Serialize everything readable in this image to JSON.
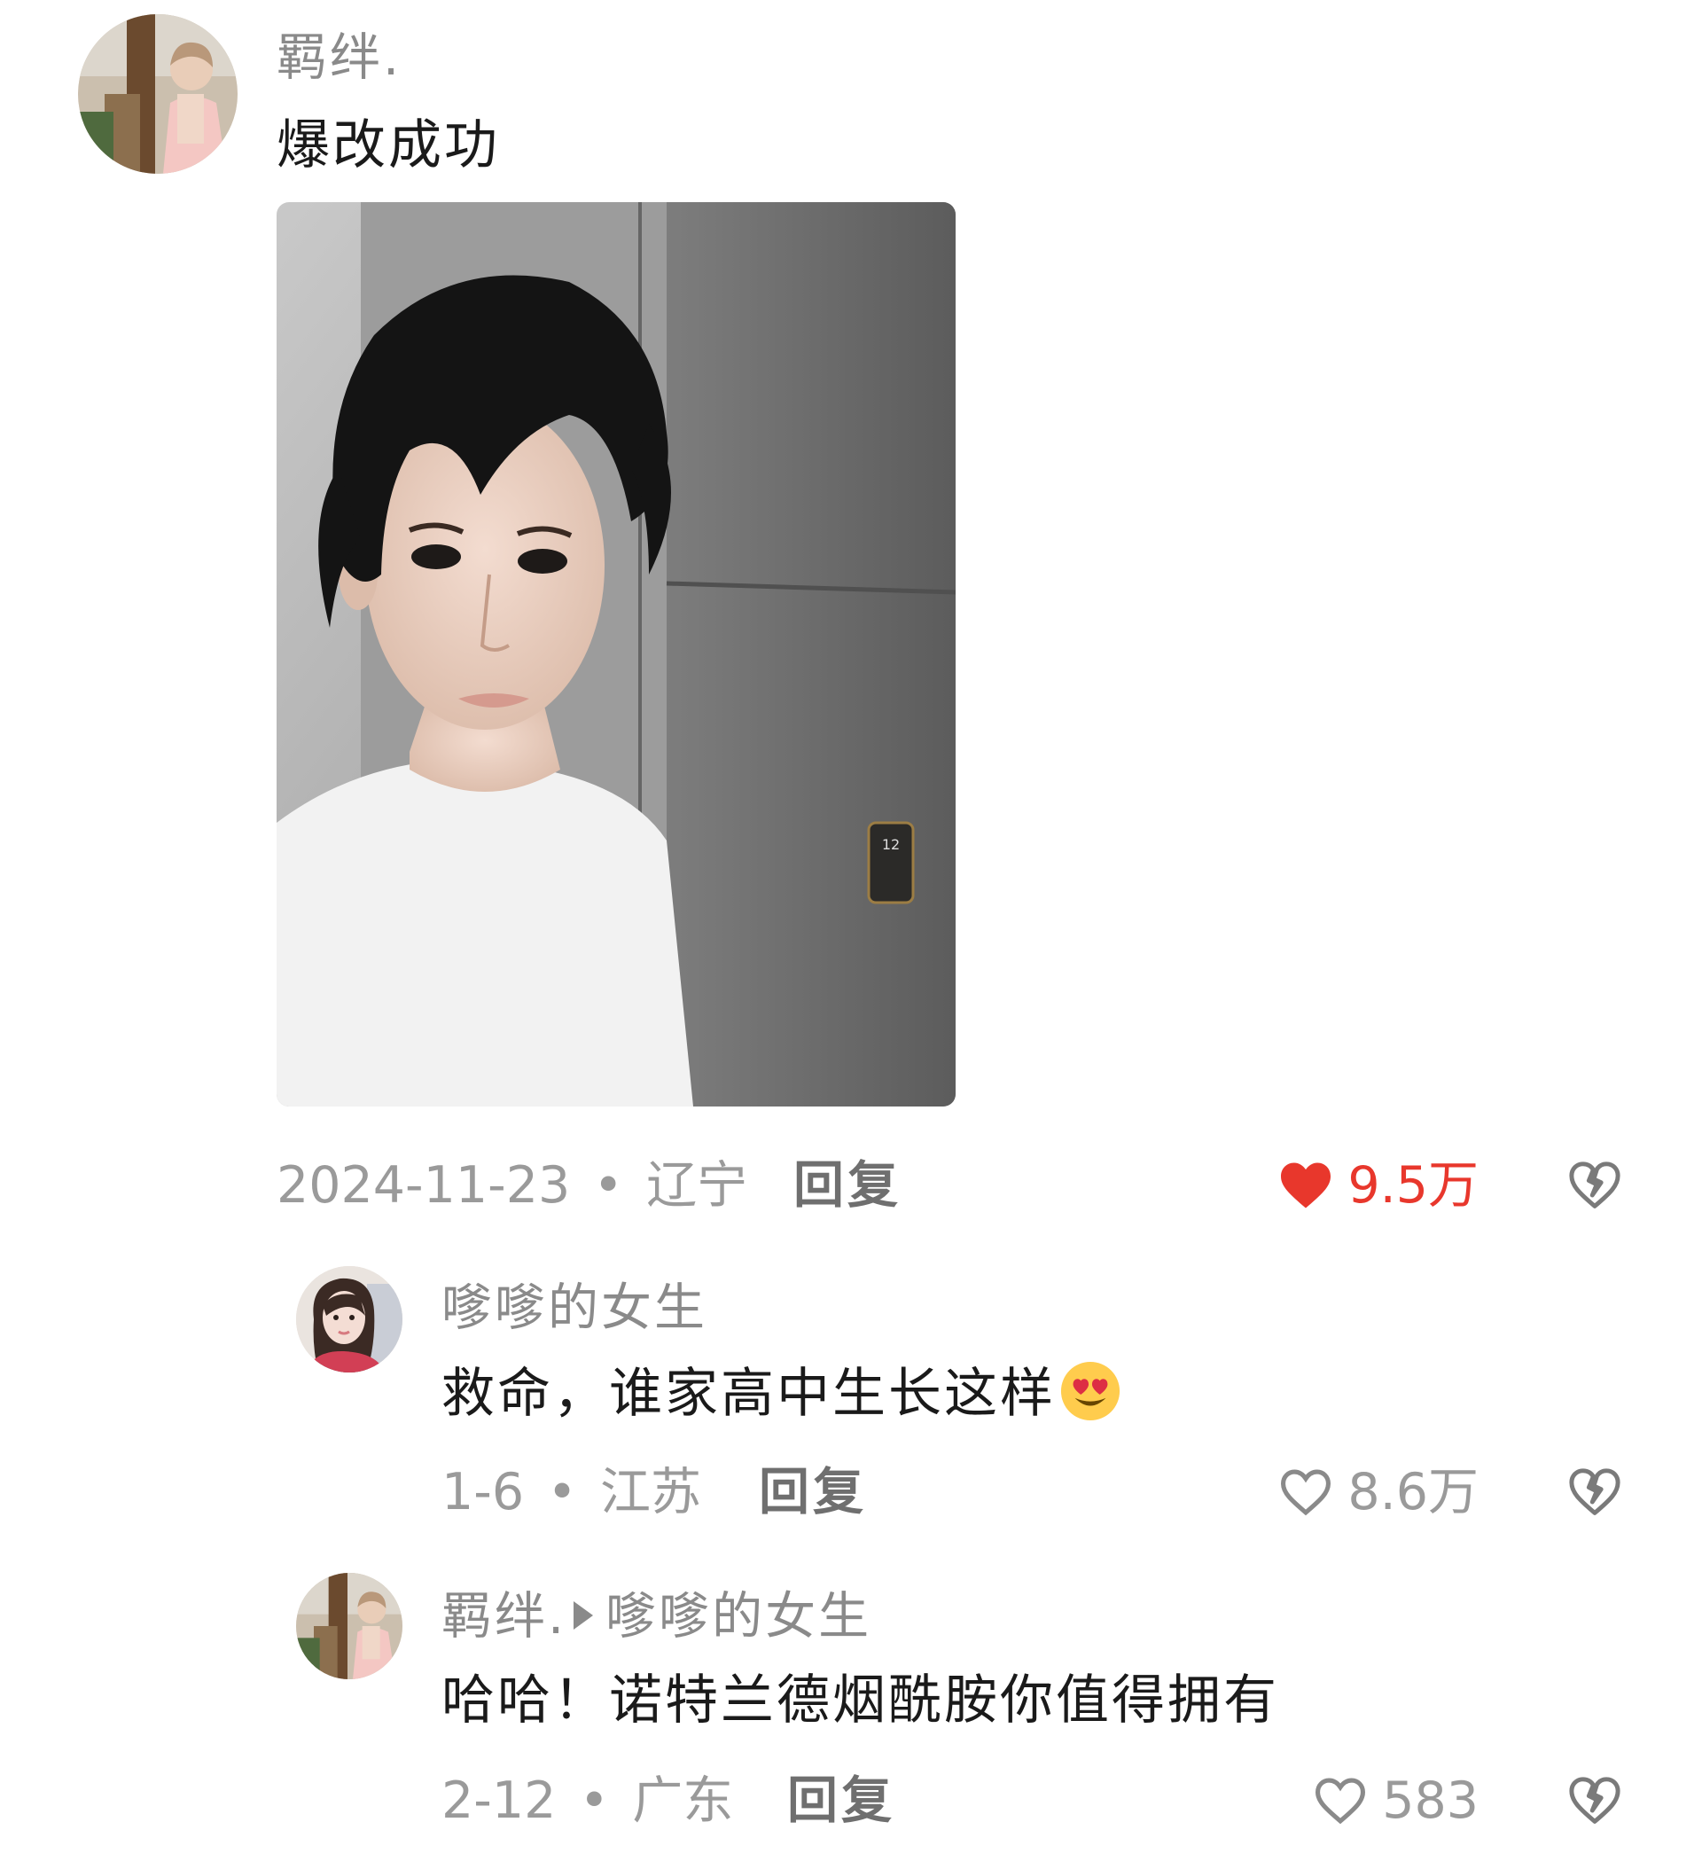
{
  "post": {
    "username": "羁绊.",
    "text": "爆改成功",
    "date": "2024-11-23",
    "location": "辽宁",
    "reply_label": "回复",
    "likes": "9.5万",
    "liked": true,
    "avatar_icon": "user-avatar-photo",
    "image_icon": "selfie-photo"
  },
  "replies": [
    {
      "username": "嗲嗲的女生",
      "text": "救命，谁家高中生长这样",
      "emoji": "smiling-face-with-heart-eyes",
      "date": "1-6",
      "location": "江苏",
      "reply_label": "回复",
      "likes": "8.6万",
      "liked": false
    },
    {
      "username": "羁绊.",
      "reply_to": "嗲嗲的女生",
      "text": "哈哈！诺特兰德烟酰胺你值得拥有",
      "date": "2-12",
      "location": "广东",
      "reply_label": "回复",
      "likes": "583",
      "liked": false
    }
  ],
  "separator": "•",
  "colors": {
    "like_active": "#e8372c",
    "meta_gray": "#9a9a9a",
    "text": "#1a1a1a"
  }
}
